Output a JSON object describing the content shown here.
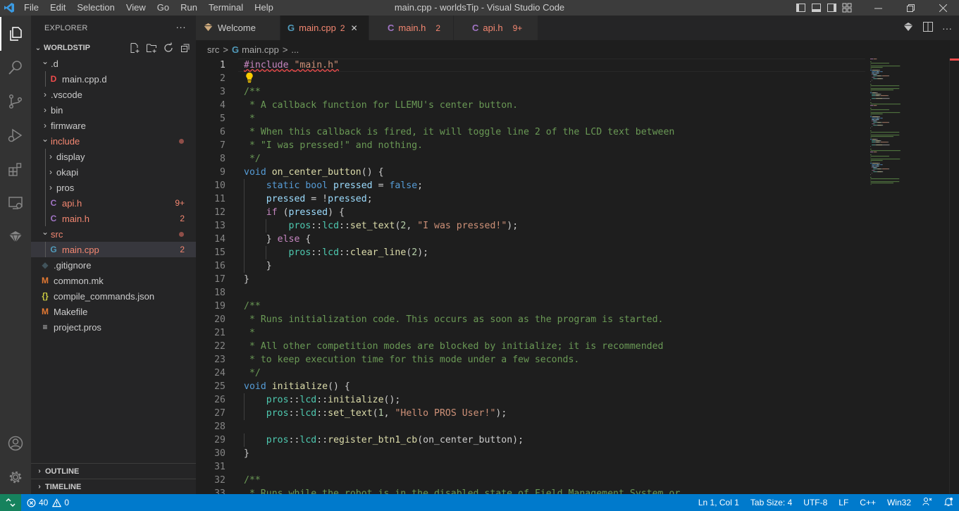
{
  "titlebar": {
    "menu": [
      "File",
      "Edit",
      "Selection",
      "View",
      "Go",
      "Run",
      "Terminal",
      "Help"
    ],
    "window_title": "main.cpp - worldsTip - Visual Studio Code"
  },
  "sidebar": {
    "header": "EXPLORER",
    "more": "···",
    "folder": "WORLDSTIP",
    "tree": [
      {
        "label": ".d",
        "depth": 1,
        "type": "folder-open",
        "color": "#cccccc"
      },
      {
        "label": "main.cpp.d",
        "depth": 2,
        "type": "file",
        "icon": "D",
        "icon_color": "#f14c4c",
        "color": "#cccccc"
      },
      {
        "label": ".vscode",
        "depth": 1,
        "type": "folder",
        "color": "#cccccc"
      },
      {
        "label": "bin",
        "depth": 1,
        "type": "folder",
        "color": "#cccccc"
      },
      {
        "label": "firmware",
        "depth": 1,
        "type": "folder",
        "color": "#cccccc"
      },
      {
        "label": "include",
        "depth": 1,
        "type": "folder-open",
        "color": "#f48771",
        "dot": true
      },
      {
        "label": "display",
        "depth": 2,
        "type": "folder",
        "color": "#cccccc"
      },
      {
        "label": "okapi",
        "depth": 2,
        "type": "folder",
        "color": "#cccccc"
      },
      {
        "label": "pros",
        "depth": 2,
        "type": "folder",
        "color": "#cccccc"
      },
      {
        "label": "api.h",
        "depth": 2,
        "type": "file",
        "icon": "C",
        "icon_color": "#a074c4",
        "color": "#f48771",
        "badge": "9+"
      },
      {
        "label": "main.h",
        "depth": 2,
        "type": "file",
        "icon": "C",
        "icon_color": "#a074c4",
        "color": "#f48771",
        "badge": "2"
      },
      {
        "label": "src",
        "depth": 1,
        "type": "folder-open",
        "color": "#f48771",
        "dot": true
      },
      {
        "label": "main.cpp",
        "depth": 2,
        "type": "file",
        "icon": "G",
        "icon_color": "#519aba",
        "color": "#f48771",
        "badge": "2",
        "selected": true
      },
      {
        "label": ".gitignore",
        "depth": 1,
        "type": "file",
        "icon": "◆",
        "icon_color": "#41535b",
        "color": "#cccccc"
      },
      {
        "label": "common.mk",
        "depth": 1,
        "type": "file",
        "icon": "M",
        "icon_color": "#e37933",
        "color": "#cccccc"
      },
      {
        "label": "compile_commands.json",
        "depth": 1,
        "type": "file",
        "icon": "{}",
        "icon_color": "#cbcb41",
        "color": "#cccccc"
      },
      {
        "label": "Makefile",
        "depth": 1,
        "type": "file",
        "icon": "M",
        "icon_color": "#e37933",
        "color": "#cccccc"
      },
      {
        "label": "project.pros",
        "depth": 1,
        "type": "file",
        "icon": "≡",
        "icon_color": "#cccccc",
        "color": "#cccccc"
      }
    ],
    "outline": "OUTLINE",
    "timeline": "TIMELINE"
  },
  "tabs": [
    {
      "label": "Welcome",
      "icon": "vscode",
      "active": false,
      "color": "#cccccc",
      "count": ""
    },
    {
      "label": "main.cpp",
      "icon": "G",
      "icon_color": "#519aba",
      "active": true,
      "color": "#f48771",
      "count": "2",
      "close": "✕"
    },
    {
      "label": "main.h",
      "icon": "C",
      "icon_color": "#a074c4",
      "active": false,
      "color": "#f48771",
      "count": "2"
    },
    {
      "label": "api.h",
      "icon": "C",
      "icon_color": "#a074c4",
      "active": false,
      "color": "#f48771",
      "count": "9+"
    }
  ],
  "breadcrumb": [
    "src",
    ">",
    "main.cpp",
    ">",
    "..."
  ],
  "editor": {
    "current_line": 1,
    "lines": [
      [
        [
          "pp squiggle",
          "#include "
        ],
        [
          "str squiggle",
          "\"main.h\""
        ]
      ],
      [],
      [
        [
          "cmt",
          "/**"
        ]
      ],
      [
        [
          "cmt",
          " * A callback function for LLEMU's center button."
        ]
      ],
      [
        [
          "cmt",
          " *"
        ]
      ],
      [
        [
          "cmt",
          " * When this callback is fired, it will toggle line 2 of the LCD text between"
        ]
      ],
      [
        [
          "cmt",
          " * \"I was pressed!\" and nothing."
        ]
      ],
      [
        [
          "cmt",
          " */"
        ]
      ],
      [
        [
          "kw",
          "void "
        ],
        [
          "fn",
          "on_center_button"
        ],
        [
          "",
          "() {"
        ]
      ],
      [
        [
          "",
          "    "
        ],
        [
          "kw",
          "static bool "
        ],
        [
          "var",
          "pressed"
        ],
        [
          "",
          " = "
        ],
        [
          "kw",
          "false"
        ],
        [
          "",
          ";"
        ]
      ],
      [
        [
          "",
          "    "
        ],
        [
          "var",
          "pressed"
        ],
        [
          "",
          " = !"
        ],
        [
          "var",
          "pressed"
        ],
        [
          "",
          ";"
        ]
      ],
      [
        [
          "",
          "    "
        ],
        [
          "pp",
          "if"
        ],
        [
          "",
          " ("
        ],
        [
          "var",
          "pressed"
        ],
        [
          "",
          ") {"
        ]
      ],
      [
        [
          "",
          "        "
        ],
        [
          "ns",
          "pros"
        ],
        [
          "",
          "::"
        ],
        [
          "ns",
          "lcd"
        ],
        [
          "",
          "::"
        ],
        [
          "fn",
          "set_text"
        ],
        [
          "",
          "("
        ],
        [
          "num",
          "2"
        ],
        [
          "",
          ", "
        ],
        [
          "str",
          "\"I was pressed!\""
        ],
        [
          "",
          ");"
        ]
      ],
      [
        [
          "",
          "    } "
        ],
        [
          "pp",
          "else"
        ],
        [
          "",
          " {"
        ]
      ],
      [
        [
          "",
          "        "
        ],
        [
          "ns",
          "pros"
        ],
        [
          "",
          "::"
        ],
        [
          "ns",
          "lcd"
        ],
        [
          "",
          "::"
        ],
        [
          "fn",
          "clear_line"
        ],
        [
          "",
          "("
        ],
        [
          "num",
          "2"
        ],
        [
          "",
          ");"
        ]
      ],
      [
        [
          "",
          "    }"
        ]
      ],
      [
        [
          "",
          "}"
        ]
      ],
      [],
      [
        [
          "cmt",
          "/**"
        ]
      ],
      [
        [
          "cmt",
          " * Runs initialization code. This occurs as soon as the program is started."
        ]
      ],
      [
        [
          "cmt",
          " *"
        ]
      ],
      [
        [
          "cmt",
          " * All other competition modes are blocked by initialize; it is recommended"
        ]
      ],
      [
        [
          "cmt",
          " * to keep execution time for this mode under a few seconds."
        ]
      ],
      [
        [
          "cmt",
          " */"
        ]
      ],
      [
        [
          "kw",
          "void "
        ],
        [
          "fn",
          "initialize"
        ],
        [
          "",
          "() {"
        ]
      ],
      [
        [
          "",
          "    "
        ],
        [
          "ns",
          "pros"
        ],
        [
          "",
          "::"
        ],
        [
          "ns",
          "lcd"
        ],
        [
          "",
          "::"
        ],
        [
          "fn",
          "initialize"
        ],
        [
          "",
          "();"
        ]
      ],
      [
        [
          "",
          "    "
        ],
        [
          "ns",
          "pros"
        ],
        [
          "",
          "::"
        ],
        [
          "ns",
          "lcd"
        ],
        [
          "",
          "::"
        ],
        [
          "fn",
          "set_text"
        ],
        [
          "",
          "("
        ],
        [
          "num",
          "1"
        ],
        [
          "",
          ", "
        ],
        [
          "str",
          "\"Hello PROS User!\""
        ],
        [
          "",
          ");"
        ]
      ],
      [],
      [
        [
          "",
          "    "
        ],
        [
          "ns",
          "pros"
        ],
        [
          "",
          "::"
        ],
        [
          "ns",
          "lcd"
        ],
        [
          "",
          "::"
        ],
        [
          "fn",
          "register_btn1_cb"
        ],
        [
          "",
          "(on_center_button);"
        ]
      ],
      [
        [
          "",
          "}"
        ]
      ],
      [],
      [
        [
          "cmt",
          "/**"
        ]
      ],
      [
        [
          "cmt",
          " * Runs while the robot is in the disabled state of Field Management System or"
        ]
      ]
    ]
  },
  "statusbar": {
    "remote": "⤫",
    "errors": "40",
    "warnings": "0",
    "position": "Ln 1, Col 1",
    "tab_size": "Tab Size: 4",
    "encoding": "UTF-8",
    "eol": "LF",
    "language": "C++",
    "platform": "Win32"
  },
  "colors": {
    "accent": "#007acc",
    "error": "#f48771",
    "comment": "#6a9955",
    "keyword": "#569cd6"
  }
}
